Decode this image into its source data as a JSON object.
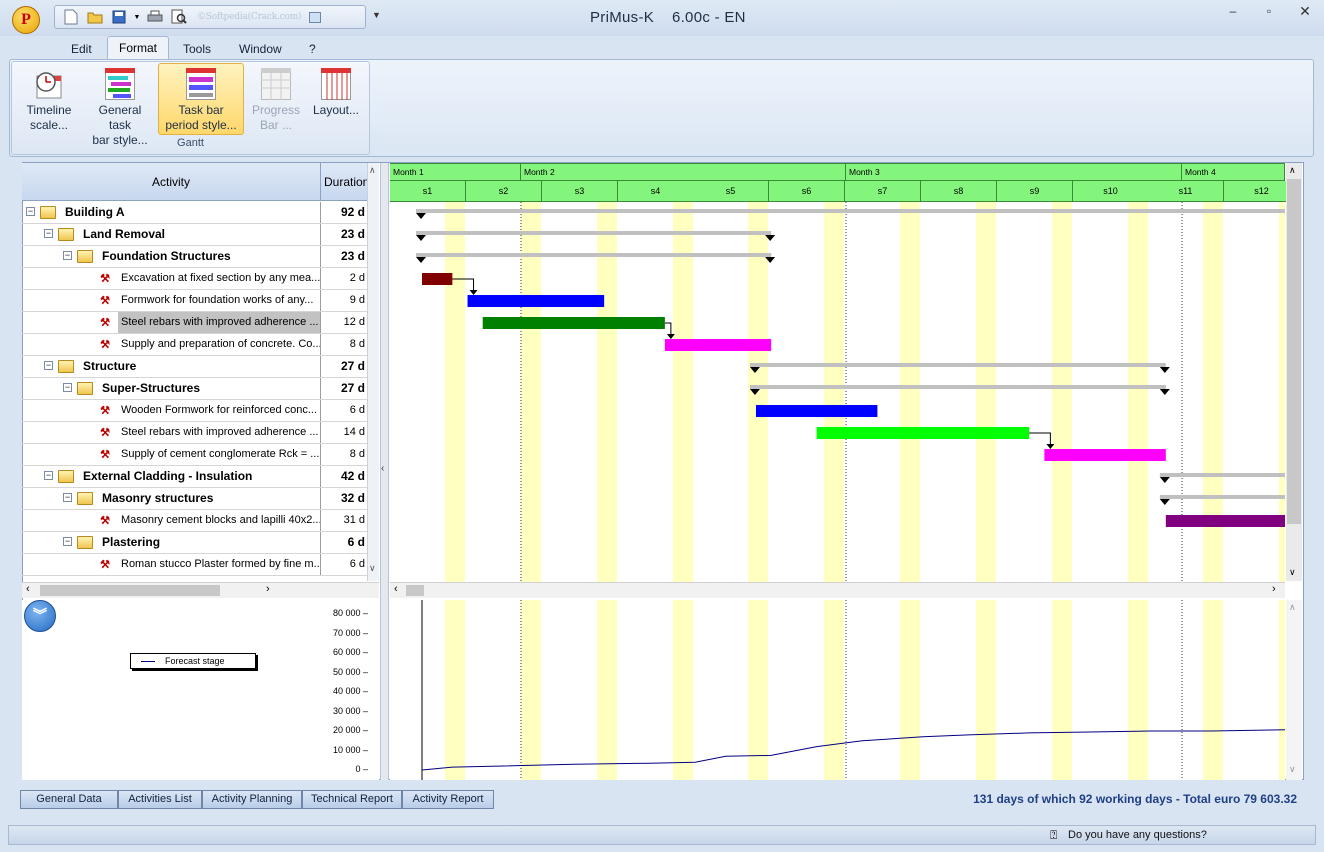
{
  "window": {
    "title": "PriMus-K    6.00c - EN",
    "qat_watermark": "©Softpedia(Crack.com)"
  },
  "menu": {
    "items": [
      "Edit",
      "Format",
      "Tools",
      "Window",
      "?"
    ]
  },
  "ribbon": {
    "buttons": [
      {
        "label1": "Timeline",
        "label2": "scale...",
        "enabled": true
      },
      {
        "label1": "General task",
        "label2": "bar style...",
        "enabled": true
      },
      {
        "label1": "Task bar",
        "label2": "period style...",
        "enabled": true
      },
      {
        "label1": "Progress",
        "label2": "Bar ...",
        "enabled": false
      },
      {
        "label1": "Layout...",
        "label2": "",
        "enabled": true
      }
    ],
    "group_label": "Gantt"
  },
  "grid": {
    "col_activity": "Activity",
    "col_duration": "Duration",
    "rows": [
      {
        "name": "Building A",
        "duration": "92 d",
        "level": 0,
        "type": "group"
      },
      {
        "name": "Land Removal",
        "duration": "23 d",
        "level": 1,
        "type": "group"
      },
      {
        "name": "Foundation Structures",
        "duration": "23 d",
        "level": 2,
        "type": "group"
      },
      {
        "name": "Excavation at fixed section by any mea...",
        "duration": "2 d",
        "level": 3,
        "type": "task"
      },
      {
        "name": "Formwork for foundation works of any...",
        "duration": "9 d",
        "level": 3,
        "type": "task"
      },
      {
        "name": "Steel rebars with improved adherence ...",
        "duration": "12 d",
        "level": 3,
        "type": "task",
        "selected": true
      },
      {
        "name": "Supply and preparation of concrete. Co...",
        "duration": "8 d",
        "level": 3,
        "type": "task"
      },
      {
        "name": "Structure",
        "duration": "27 d",
        "level": 1,
        "type": "group"
      },
      {
        "name": "Super-Structures",
        "duration": "27 d",
        "level": 2,
        "type": "group"
      },
      {
        "name": "Wooden Formwork for reinforced conc...",
        "duration": "6 d",
        "level": 3,
        "type": "task"
      },
      {
        "name": "Steel rebars with improved adherence ...",
        "duration": "14 d",
        "level": 3,
        "type": "task"
      },
      {
        "name": "Supply of cement conglomerate Rck = ...",
        "duration": "8 d",
        "level": 3,
        "type": "task"
      },
      {
        "name": "External Cladding - Insulation",
        "duration": "42 d",
        "level": 1,
        "type": "group"
      },
      {
        "name": "Masonry structures",
        "duration": "32 d",
        "level": 2,
        "type": "group"
      },
      {
        "name": "Masonry cement blocks and lapilli 40x2...",
        "duration": "31 d",
        "level": 3,
        "type": "task"
      },
      {
        "name": "Plastering",
        "duration": "6 d",
        "level": 2,
        "type": "group"
      },
      {
        "name": "Roman stucco Plaster formed by fine m...",
        "duration": "6 d",
        "level": 3,
        "type": "task"
      }
    ]
  },
  "timeline": {
    "months": [
      "Month 1",
      "Month 2",
      "Month 3",
      "Month 4"
    ],
    "weeks": [
      "s1",
      "s2",
      "s3",
      "s4",
      "s5",
      "s6",
      "s7",
      "s8",
      "s9",
      "s10",
      "s11",
      "s12"
    ]
  },
  "gantt": {
    "colors": {
      "summary": "#c0c0c0",
      "weekend": "#ffffc0"
    },
    "bars": [
      {
        "row": 0,
        "start": 0,
        "end": 92,
        "kind": "summary"
      },
      {
        "row": 1,
        "start": 0,
        "end": 23,
        "kind": "summary"
      },
      {
        "row": 2,
        "start": 0,
        "end": 23,
        "kind": "summary"
      },
      {
        "row": 3,
        "start": 0,
        "end": 2,
        "kind": "task",
        "color": "#800000"
      },
      {
        "row": 4,
        "start": 3,
        "end": 12,
        "kind": "task",
        "color": "#0000ff"
      },
      {
        "row": 5,
        "start": 4,
        "end": 16,
        "kind": "task",
        "color": "#008000"
      },
      {
        "row": 6,
        "start": 16,
        "end": 23,
        "kind": "task",
        "color": "#ff00ff"
      },
      {
        "row": 7,
        "start": 22,
        "end": 49,
        "kind": "summary"
      },
      {
        "row": 8,
        "start": 22,
        "end": 49,
        "kind": "summary"
      },
      {
        "row": 9,
        "start": 22,
        "end": 30,
        "kind": "task",
        "color": "#0000ff"
      },
      {
        "row": 10,
        "start": 26,
        "end": 40,
        "kind": "task",
        "color": "#00ff00"
      },
      {
        "row": 11,
        "start": 41,
        "end": 49,
        "kind": "task",
        "color": "#ff00ff"
      },
      {
        "row": 12,
        "start": 49,
        "end": 92,
        "kind": "summary"
      },
      {
        "row": 13,
        "start": 49,
        "end": 81,
        "kind": "summary"
      },
      {
        "row": 14,
        "start": 49,
        "end": 80,
        "kind": "task",
        "color": "#800080"
      }
    ]
  },
  "chart_data": {
    "type": "line",
    "series": [
      {
        "name": "Forecast stage",
        "color": "#000080",
        "x": [
          0,
          2,
          5,
          10,
          15,
          18,
          20,
          23,
          26,
          29,
          31,
          33,
          36,
          40,
          44,
          48,
          52,
          56,
          60,
          61,
          63,
          66,
          68,
          70,
          71,
          72,
          74,
          76,
          77,
          80
        ],
        "y": [
          0,
          1500,
          2000,
          3000,
          3500,
          4000,
          7000,
          7500,
          12000,
          15000,
          16000,
          17000,
          18000,
          19000,
          19500,
          20000,
          20000,
          20500,
          21000,
          21500,
          25000,
          31000,
          31500,
          34000,
          35000,
          37000,
          37500,
          40000,
          41000,
          43000
        ]
      }
    ],
    "yticks": [
      "80 000",
      "70 000",
      "60 000",
      "50 000",
      "40 000",
      "30 000",
      "20 000",
      "10 000",
      "0"
    ],
    "ylim": [
      0,
      80000
    ]
  },
  "bottom_tabs": [
    "General Data",
    "Activities List",
    "Activity Planning",
    "Technical Report",
    "Activity Report"
  ],
  "summary": "131 days of which 92 working days - Total euro 79 603.32",
  "status": {
    "help": "Do you have any questions?"
  }
}
